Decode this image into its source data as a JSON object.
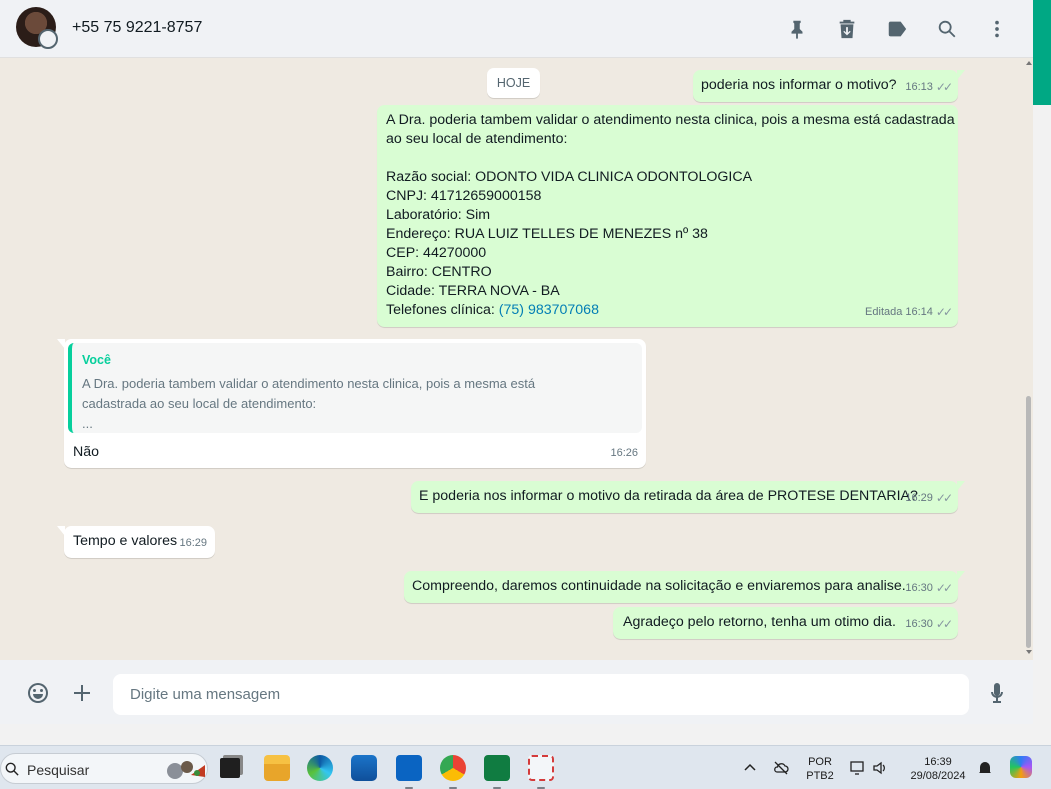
{
  "header": {
    "contact_name": "+55 75 9221-8757",
    "icons": [
      "pin-icon",
      "archive-icon",
      "label-icon",
      "search-icon",
      "menu-icon"
    ]
  },
  "chat": {
    "day_label": "HOJE",
    "messages": [
      {
        "direction": "out",
        "text": "poderia nos informar o motivo?",
        "time": "16:13"
      },
      {
        "direction": "out",
        "text_intro": "A Dra. poderia tambem validar o atendimento nesta clinica, pois a mesma está cadastrada\nao seu local de atendimento:\n\nRazão social: ODONTO VIDA CLINICA ODONTOLOGICA\nCNPJ: 41712659000158\nLaboratório: Sim\nEndereço: RUA LUIZ TELLES DE MENEZES nº 38\nCEP: 44270000\nBairro: CENTRO\nCidade: TERRA NOVA - BA",
        "phone_label": "Telefones clínica: ",
        "phone_link": "(75) 983707068",
        "edited_label": "Editada",
        "time": "16:14"
      },
      {
        "direction": "in",
        "quote_author": "Você",
        "quote_text": "A Dra. poderia tambem validar o atendimento nesta clinica, pois a mesma está\ncadastrada ao seu local de atendimento:\n...",
        "text": "Não",
        "time": "16:26"
      },
      {
        "direction": "out",
        "text": "E poderia nos informar o motivo da retirada da área de PROTESE DENTARIA?",
        "time": "16:29"
      },
      {
        "direction": "in",
        "text": "Tempo e valores",
        "time": "16:29"
      },
      {
        "direction": "out",
        "text": "Compreendo, daremos continuidade na solicitação e enviaremos para analise.",
        "time": "16:30"
      },
      {
        "direction": "out",
        "text": "Agradeço pelo retorno, tenha um otimo dia.",
        "time": "16:30"
      }
    ],
    "tick_glyph": "✓✓"
  },
  "compose": {
    "placeholder": "Digite uma mensagem",
    "icons": [
      "emoji-icon",
      "attach-plus-icon",
      "microphone-icon"
    ]
  },
  "taskbar": {
    "search_label": "Pesquisar",
    "apps": [
      "task-view",
      "file-explorer",
      "edge",
      "store",
      "outlook",
      "chrome",
      "excel",
      "snipping-tool"
    ],
    "language_line1": "POR",
    "language_line2": "PTB2",
    "time": "16:39",
    "date": "29/08/2024"
  },
  "colors": {
    "outgoing_bubble": "#d9fdd3",
    "incoming_bubble": "#ffffff",
    "accent_green": "#00a884",
    "quote_bar": "#06cf9c",
    "link": "#027eb5",
    "chat_bg": "#efeae2"
  }
}
